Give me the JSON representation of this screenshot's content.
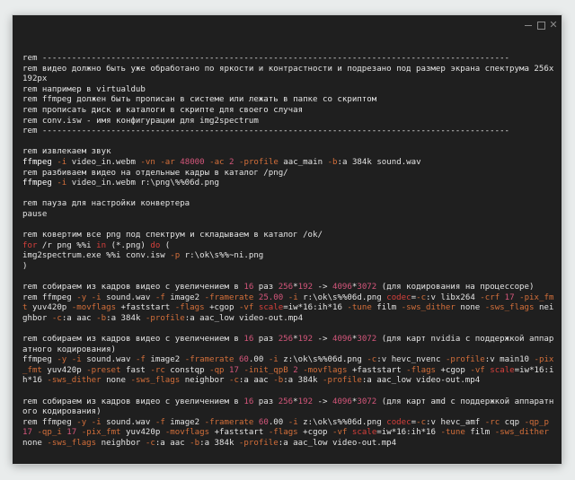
{
  "window": {
    "controls": [
      {
        "name": "minimize-button",
        "icon": "minimize-icon"
      },
      {
        "name": "maximize-button",
        "icon": "maximize-icon"
      },
      {
        "name": "close-button",
        "label": "✕",
        "icon": "close-icon"
      }
    ]
  },
  "colors": {
    "background": "#1f1f1f",
    "text": "#e4e4e4",
    "command": "#ffffff",
    "flag": "#d46f3a",
    "number": "#d4567b",
    "keyword": "#d6403c"
  },
  "lines": [
    [
      [
        "text",
        "rem -----------------------------------------------------------------------------------------------"
      ]
    ],
    [
      [
        "text",
        "rem видео должно быть уже обработано по яркости и контрастности и подрезано под размер экрана спектрума 256x192px"
      ]
    ],
    [
      [
        "text",
        "rem например в virtualdub"
      ]
    ],
    [
      [
        "text",
        "rem ffmpeg должен быть прописан в системе или лежать в папке со скриптом"
      ]
    ],
    [
      [
        "text",
        "rem прописать диск и каталоги в скрипте для своего случая"
      ]
    ],
    [
      [
        "text",
        "rem conv.isw - имя конфигурации для img2spectrum"
      ]
    ],
    [
      [
        "text",
        "rem -----------------------------------------------------------------------------------------------"
      ]
    ],
    [],
    [
      [
        "text",
        "rem извлекаем звук"
      ]
    ],
    [
      [
        "cmd",
        "ffmpeg "
      ],
      [
        "flag",
        "-i"
      ],
      [
        "text",
        " video_in.webm "
      ],
      [
        "flag",
        "-vn"
      ],
      [
        "text",
        " "
      ],
      [
        "flag",
        "-ar"
      ],
      [
        "text",
        " "
      ],
      [
        "num",
        "48000"
      ],
      [
        "text",
        " "
      ],
      [
        "flag",
        "-ac"
      ],
      [
        "text",
        " "
      ],
      [
        "num",
        "2"
      ],
      [
        "text",
        " "
      ],
      [
        "flag",
        "-profile"
      ],
      [
        "text",
        " aac_main "
      ],
      [
        "flag",
        "-b"
      ],
      [
        "text",
        ":a 384k sound.wav"
      ]
    ],
    [
      [
        "text",
        "rem разбиваем видео на отдельные кадры в каталог /png/"
      ]
    ],
    [
      [
        "cmd",
        "ffmpeg "
      ],
      [
        "flag",
        "-i"
      ],
      [
        "text",
        " video_in.webm r:\\png\\%%06d.png"
      ]
    ],
    [],
    [
      [
        "text",
        "rem пауза для настройки конвертера"
      ]
    ],
    [
      [
        "text",
        "pause"
      ]
    ],
    [],
    [
      [
        "text",
        "rem ковертим все png под спектрум и складываем в каталог /ok/"
      ]
    ],
    [
      [
        "kw",
        "for"
      ],
      [
        "text",
        " /r png %%i "
      ],
      [
        "kw",
        "in"
      ],
      [
        "text",
        " (*.png) "
      ],
      [
        "kw",
        "do"
      ],
      [
        "text",
        " ("
      ]
    ],
    [
      [
        "text",
        "img2spectrum.exe %%i conv.isw "
      ],
      [
        "flag",
        "-p"
      ],
      [
        "text",
        " r:\\ok\\s%%~ni.png"
      ]
    ],
    [
      [
        "text",
        ")"
      ]
    ],
    [],
    [
      [
        "text",
        "rem собираем из кадров видео с увеличением в "
      ],
      [
        "num",
        "16"
      ],
      [
        "text",
        " раз "
      ],
      [
        "num",
        "256"
      ],
      [
        "text",
        "*"
      ],
      [
        "num",
        "192"
      ],
      [
        "text",
        " -> "
      ],
      [
        "num",
        "4096"
      ],
      [
        "text",
        "*"
      ],
      [
        "num",
        "3072"
      ],
      [
        "text",
        " (для кодирования на процессоре)"
      ]
    ],
    [
      [
        "text",
        "rem ffmpeg "
      ],
      [
        "flag",
        "-y"
      ],
      [
        "text",
        " "
      ],
      [
        "flag",
        "-i"
      ],
      [
        "text",
        " sound.wav "
      ],
      [
        "flag",
        "-f"
      ],
      [
        "text",
        " image2 "
      ],
      [
        "flag",
        "-framerate"
      ],
      [
        "text",
        " "
      ],
      [
        "num",
        "25.00"
      ],
      [
        "text",
        " "
      ],
      [
        "flag",
        "-i"
      ],
      [
        "text",
        " r:\\ok\\s%%06d.png "
      ],
      [
        "kw",
        "codec"
      ],
      [
        "text",
        "="
      ],
      [
        "flag",
        "-c"
      ],
      [
        "text",
        ":v libx264 "
      ],
      [
        "flag",
        "-crf"
      ],
      [
        "text",
        " "
      ],
      [
        "num",
        "17"
      ],
      [
        "text",
        " "
      ],
      [
        "flag",
        "-pix_fmt"
      ],
      [
        "text",
        " yuv420p "
      ],
      [
        "flag",
        "-movflags"
      ],
      [
        "text",
        " +faststart "
      ],
      [
        "flag",
        "-flags"
      ],
      [
        "text",
        " +cgop "
      ],
      [
        "flag",
        "-vf"
      ],
      [
        "text",
        " "
      ],
      [
        "kw",
        "scale"
      ],
      [
        "text",
        "=iw*16:ih*16 "
      ],
      [
        "flag",
        "-tune"
      ],
      [
        "text",
        " film "
      ],
      [
        "flag",
        "-sws_dither"
      ],
      [
        "text",
        " none "
      ],
      [
        "flag",
        "-sws_flags"
      ],
      [
        "text",
        " neighbor "
      ],
      [
        "flag",
        "-c"
      ],
      [
        "text",
        ":a aac "
      ],
      [
        "flag",
        "-b"
      ],
      [
        "text",
        ":a 384k "
      ],
      [
        "flag",
        "-profile"
      ],
      [
        "text",
        ":a aac_low video-out.mp4"
      ]
    ],
    [],
    [
      [
        "text",
        "rem собираем из кадров видео с увеличением в "
      ],
      [
        "num",
        "16"
      ],
      [
        "text",
        " раз "
      ],
      [
        "num",
        "256"
      ],
      [
        "text",
        "*"
      ],
      [
        "num",
        "192"
      ],
      [
        "text",
        " -> "
      ],
      [
        "num",
        "4096"
      ],
      [
        "text",
        "*"
      ],
      [
        "num",
        "3072"
      ],
      [
        "text",
        " (для карт nvidia с поддержкой аппаратного кодирования)"
      ]
    ],
    [
      [
        "text",
        "ffmpeg "
      ],
      [
        "flag",
        "-y"
      ],
      [
        "text",
        " "
      ],
      [
        "flag",
        "-i"
      ],
      [
        "text",
        " sound.wav "
      ],
      [
        "flag",
        "-f"
      ],
      [
        "text",
        " image2 "
      ],
      [
        "flag",
        "-framerate"
      ],
      [
        "text",
        " "
      ],
      [
        "num",
        "60"
      ],
      [
        "text",
        ".00 "
      ],
      [
        "flag",
        "-i"
      ],
      [
        "text",
        " z:\\ok\\s%%06d.png "
      ],
      [
        "flag",
        "-c"
      ],
      [
        "text",
        ":v hevc_nvenc "
      ],
      [
        "flag",
        "-profile"
      ],
      [
        "text",
        ":v main10 "
      ],
      [
        "flag",
        "-pix_fmt"
      ],
      [
        "text",
        " yuv420p "
      ],
      [
        "flag",
        "-preset"
      ],
      [
        "text",
        " fast "
      ],
      [
        "flag",
        "-rc"
      ],
      [
        "text",
        " constqp "
      ],
      [
        "flag",
        "-qp"
      ],
      [
        "text",
        " "
      ],
      [
        "num",
        "17"
      ],
      [
        "text",
        " "
      ],
      [
        "flag",
        "-init_qpB"
      ],
      [
        "text",
        " "
      ],
      [
        "num",
        "2"
      ],
      [
        "text",
        " "
      ],
      [
        "flag",
        "-movflags"
      ],
      [
        "text",
        " +faststart "
      ],
      [
        "flag",
        "-flags"
      ],
      [
        "text",
        " +cgop "
      ],
      [
        "flag",
        "-vf"
      ],
      [
        "text",
        " "
      ],
      [
        "kw",
        "scale"
      ],
      [
        "text",
        "=iw*16:ih*16 "
      ],
      [
        "flag",
        "-sws_dither"
      ],
      [
        "text",
        " none "
      ],
      [
        "flag",
        "-sws_flags"
      ],
      [
        "text",
        " neighbor "
      ],
      [
        "flag",
        "-c"
      ],
      [
        "text",
        ":a aac "
      ],
      [
        "flag",
        "-b"
      ],
      [
        "text",
        ":a 384k "
      ],
      [
        "flag",
        "-profile"
      ],
      [
        "text",
        ":a aac_low video-out.mp4"
      ]
    ],
    [],
    [
      [
        "text",
        "rem собираем из кадров видео с увеличением в "
      ],
      [
        "num",
        "16"
      ],
      [
        "text",
        " раз "
      ],
      [
        "num",
        "256"
      ],
      [
        "text",
        "*"
      ],
      [
        "num",
        "192"
      ],
      [
        "text",
        " -> "
      ],
      [
        "num",
        "4096"
      ],
      [
        "text",
        "*"
      ],
      [
        "num",
        "3072"
      ],
      [
        "text",
        " (для карт amd с поддержкой аппаратного кодирования)"
      ]
    ],
    [
      [
        "text",
        "rem ffmpeg "
      ],
      [
        "flag",
        "-y"
      ],
      [
        "text",
        " "
      ],
      [
        "flag",
        "-i"
      ],
      [
        "text",
        " sound.wav "
      ],
      [
        "flag",
        "-f"
      ],
      [
        "text",
        " image2 "
      ],
      [
        "flag",
        "-framerate"
      ],
      [
        "text",
        " "
      ],
      [
        "num",
        "60"
      ],
      [
        "text",
        ".00 "
      ],
      [
        "flag",
        "-i"
      ],
      [
        "text",
        " z:\\ok\\s%%06d.png "
      ],
      [
        "kw",
        "codec"
      ],
      [
        "text",
        "="
      ],
      [
        "flag",
        "-c"
      ],
      [
        "text",
        ":v hevc_amf "
      ],
      [
        "flag",
        "-rc"
      ],
      [
        "text",
        " cqp "
      ],
      [
        "flag",
        "-qp_p"
      ],
      [
        "text",
        " "
      ],
      [
        "num",
        "17"
      ],
      [
        "text",
        " "
      ],
      [
        "flag",
        "-qp_i"
      ],
      [
        "text",
        " "
      ],
      [
        "num",
        "17"
      ],
      [
        "text",
        " "
      ],
      [
        "flag",
        "-pix_fmt"
      ],
      [
        "text",
        " yuv420p "
      ],
      [
        "flag",
        "-movflags"
      ],
      [
        "text",
        " +faststart "
      ],
      [
        "flag",
        "-flags"
      ],
      [
        "text",
        " +cgop "
      ],
      [
        "flag",
        "-vf"
      ],
      [
        "text",
        " "
      ],
      [
        "kw",
        "scale"
      ],
      [
        "text",
        "=iw*16:ih*16 "
      ],
      [
        "flag",
        "-tune"
      ],
      [
        "text",
        " film "
      ],
      [
        "flag",
        "-sws_dither"
      ],
      [
        "text",
        " none "
      ],
      [
        "flag",
        "-sws_flags"
      ],
      [
        "text",
        " neighbor "
      ],
      [
        "flag",
        "-c"
      ],
      [
        "text",
        ":a aac "
      ],
      [
        "flag",
        "-b"
      ],
      [
        "text",
        ":a 384k "
      ],
      [
        "flag",
        "-profile"
      ],
      [
        "text",
        ":a aac_low video-out.mp4"
      ]
    ]
  ]
}
